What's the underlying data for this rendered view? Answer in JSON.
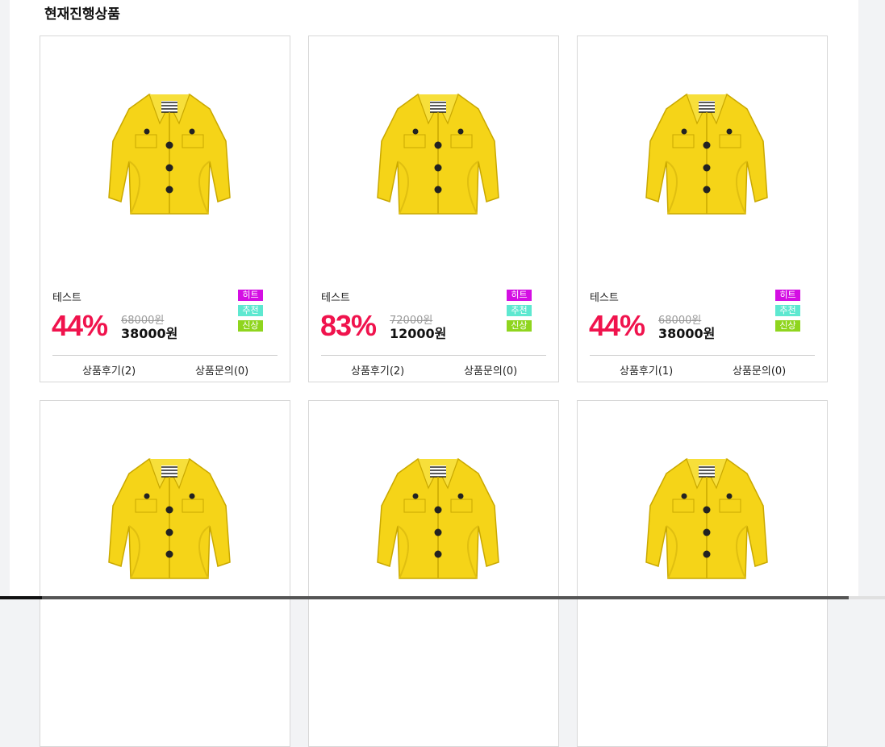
{
  "section": {
    "title": "현재진행상품"
  },
  "colors": {
    "hit": "#d40fe3",
    "recommend": "#5ee8d0",
    "new": "#8fd51e",
    "discount": "#f0134d"
  },
  "products": [
    {
      "name": "테스트",
      "discount": "44%",
      "original_price": "68000원",
      "sale_price": "38000원",
      "badges": {
        "hit": "히트",
        "recommend": "추천",
        "new": "신상"
      },
      "reviews": "상품후기(2)",
      "qna": "상품문의(0)"
    },
    {
      "name": "테스트",
      "discount": "83%",
      "original_price": "72000원",
      "sale_price": "12000원",
      "badges": {
        "hit": "히트",
        "recommend": "추천",
        "new": "신상"
      },
      "reviews": "상품후기(2)",
      "qna": "상품문의(0)"
    },
    {
      "name": "테스트",
      "discount": "44%",
      "original_price": "68000원",
      "sale_price": "38000원",
      "badges": {
        "hit": "히트",
        "recommend": "추천",
        "new": "신상"
      },
      "reviews": "상품후기(1)",
      "qna": "상품문의(0)"
    }
  ]
}
